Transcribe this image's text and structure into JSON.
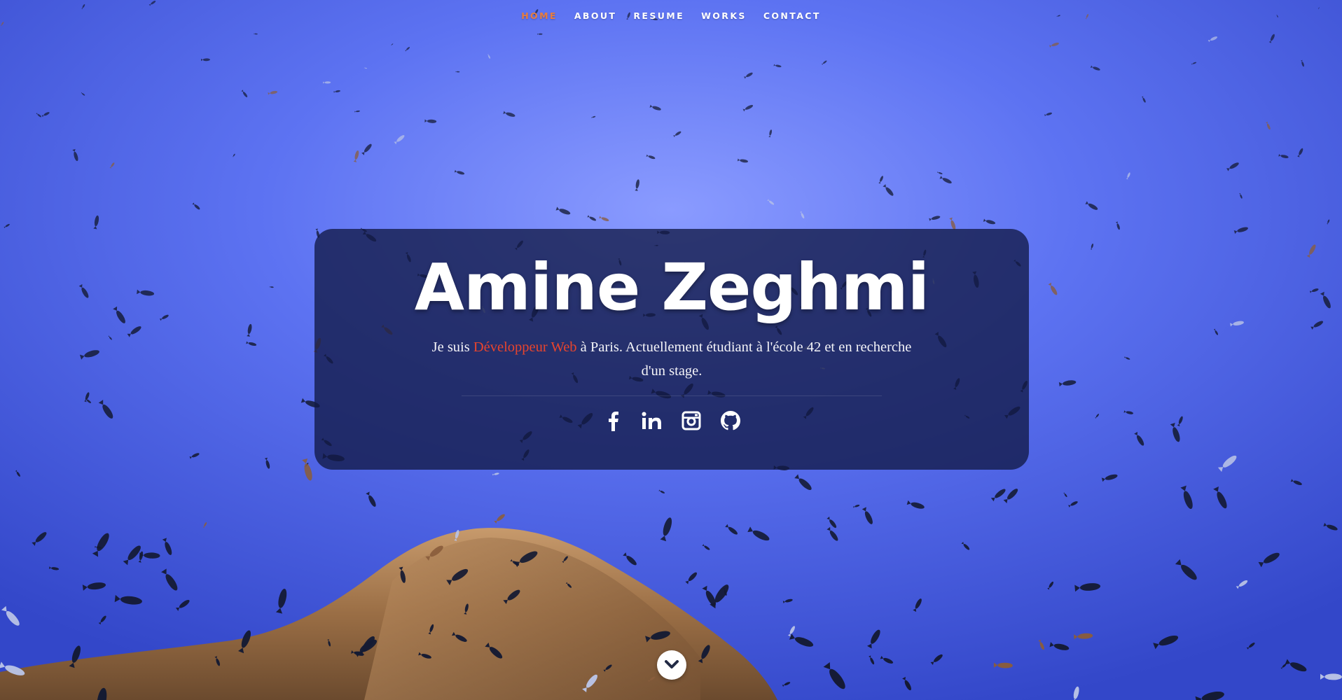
{
  "nav": {
    "items": [
      {
        "label": "Home",
        "active": true
      },
      {
        "label": "About",
        "active": false
      },
      {
        "label": "Resume",
        "active": false
      },
      {
        "label": "Works",
        "active": false
      },
      {
        "label": "Contact",
        "active": false
      }
    ]
  },
  "hero": {
    "title": "Amine Zeghmi",
    "text_before": "Je suis ",
    "text_accent": "Développeur Web",
    "text_after": " à Paris. Actuellement étudiant à l'école 42 et en recherche d'un stage."
  },
  "social": [
    {
      "icon": "facebook-icon"
    },
    {
      "icon": "linkedin-icon"
    },
    {
      "icon": "instagram-icon"
    },
    {
      "icon": "github-icon"
    }
  ],
  "scroll_down": {
    "icon": "chevron-down-icon"
  },
  "colors": {
    "accent_nav": "#e87d3e",
    "accent_text": "#e8442d",
    "card_bg": "rgba(18, 26, 70, 0.78)",
    "water": "#5a70f0"
  }
}
